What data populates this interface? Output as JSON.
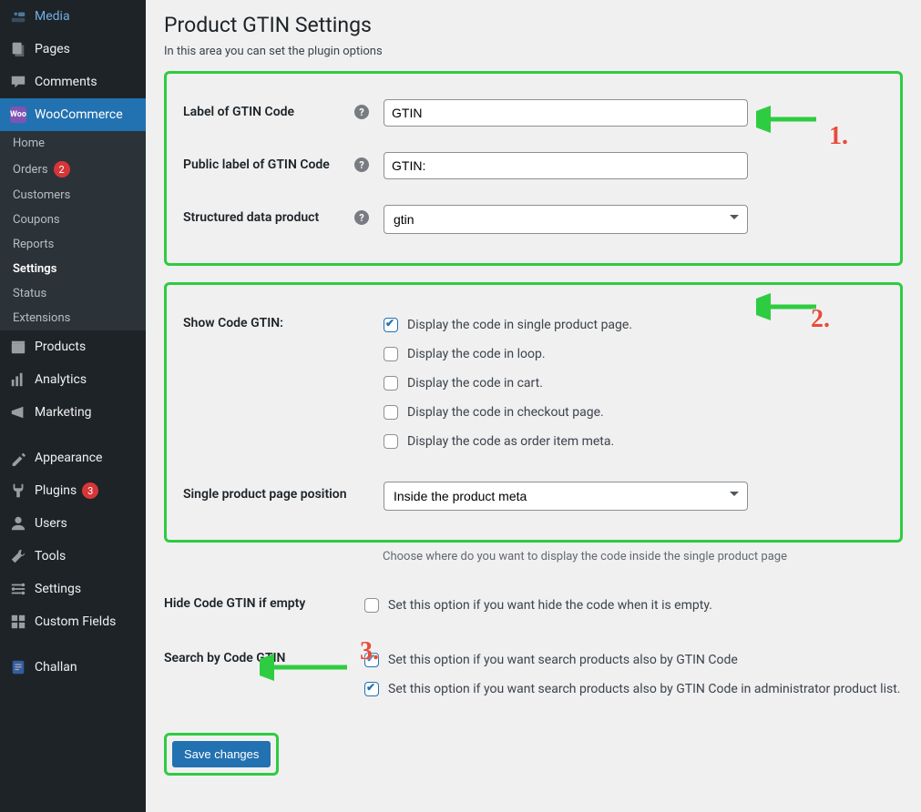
{
  "sidebar": {
    "items": [
      {
        "id": "media",
        "label": "Media"
      },
      {
        "id": "pages",
        "label": "Pages"
      },
      {
        "id": "comments",
        "label": "Comments"
      },
      {
        "id": "woocommerce",
        "label": "WooCommerce"
      },
      {
        "id": "products",
        "label": "Products"
      },
      {
        "id": "analytics",
        "label": "Analytics"
      },
      {
        "id": "marketing",
        "label": "Marketing"
      },
      {
        "id": "appearance",
        "label": "Appearance"
      },
      {
        "id": "plugins",
        "label": "Plugins",
        "badge": "3"
      },
      {
        "id": "users",
        "label": "Users"
      },
      {
        "id": "tools",
        "label": "Tools"
      },
      {
        "id": "settings",
        "label": "Settings"
      },
      {
        "id": "custom-fields",
        "label": "Custom Fields"
      },
      {
        "id": "challan",
        "label": "Challan"
      }
    ],
    "submenu": [
      {
        "id": "home",
        "label": "Home"
      },
      {
        "id": "orders",
        "label": "Orders",
        "badge": "2"
      },
      {
        "id": "customers",
        "label": "Customers"
      },
      {
        "id": "coupons",
        "label": "Coupons"
      },
      {
        "id": "reports",
        "label": "Reports"
      },
      {
        "id": "wc-settings",
        "label": "Settings"
      },
      {
        "id": "status",
        "label": "Status"
      },
      {
        "id": "extensions",
        "label": "Extensions"
      }
    ]
  },
  "page": {
    "title": "Product GTIN Settings",
    "description": "In this area you can set the plugin options"
  },
  "form": {
    "label_of_gtin": {
      "label": "Label of GTIN Code",
      "value": "GTIN"
    },
    "public_label": {
      "label": "Public label of GTIN Code",
      "value": "GTIN:"
    },
    "structured_data": {
      "label": "Structured data product",
      "value": "gtin"
    },
    "show_code": {
      "label": "Show Code GTIN:",
      "options": [
        {
          "label": "Display the code in single product page.",
          "checked": true
        },
        {
          "label": "Display the code in loop.",
          "checked": false
        },
        {
          "label": "Display the code in cart.",
          "checked": false
        },
        {
          "label": "Display the code in checkout page.",
          "checked": false
        },
        {
          "label": "Display the code as order item meta.",
          "checked": false
        }
      ]
    },
    "position": {
      "label": "Single product page position",
      "value": "Inside the product meta",
      "hint": "Choose where do you want to display the code inside the single product page"
    },
    "hide_if_empty": {
      "label": "Hide Code GTIN if empty",
      "option": "Set this option if you want hide the code when it is empty.",
      "checked": false
    },
    "search": {
      "label": "Search by Code GTIN",
      "options": [
        {
          "label": "Set this option if you want search products also by GTIN Code",
          "checked": true
        },
        {
          "label": "Set this option if you want search products also by GTIN Code in administrator product list.",
          "checked": true
        }
      ]
    },
    "save": "Save changes"
  },
  "annotations": {
    "a1": "1.",
    "a2": "2.",
    "a3": "3."
  }
}
